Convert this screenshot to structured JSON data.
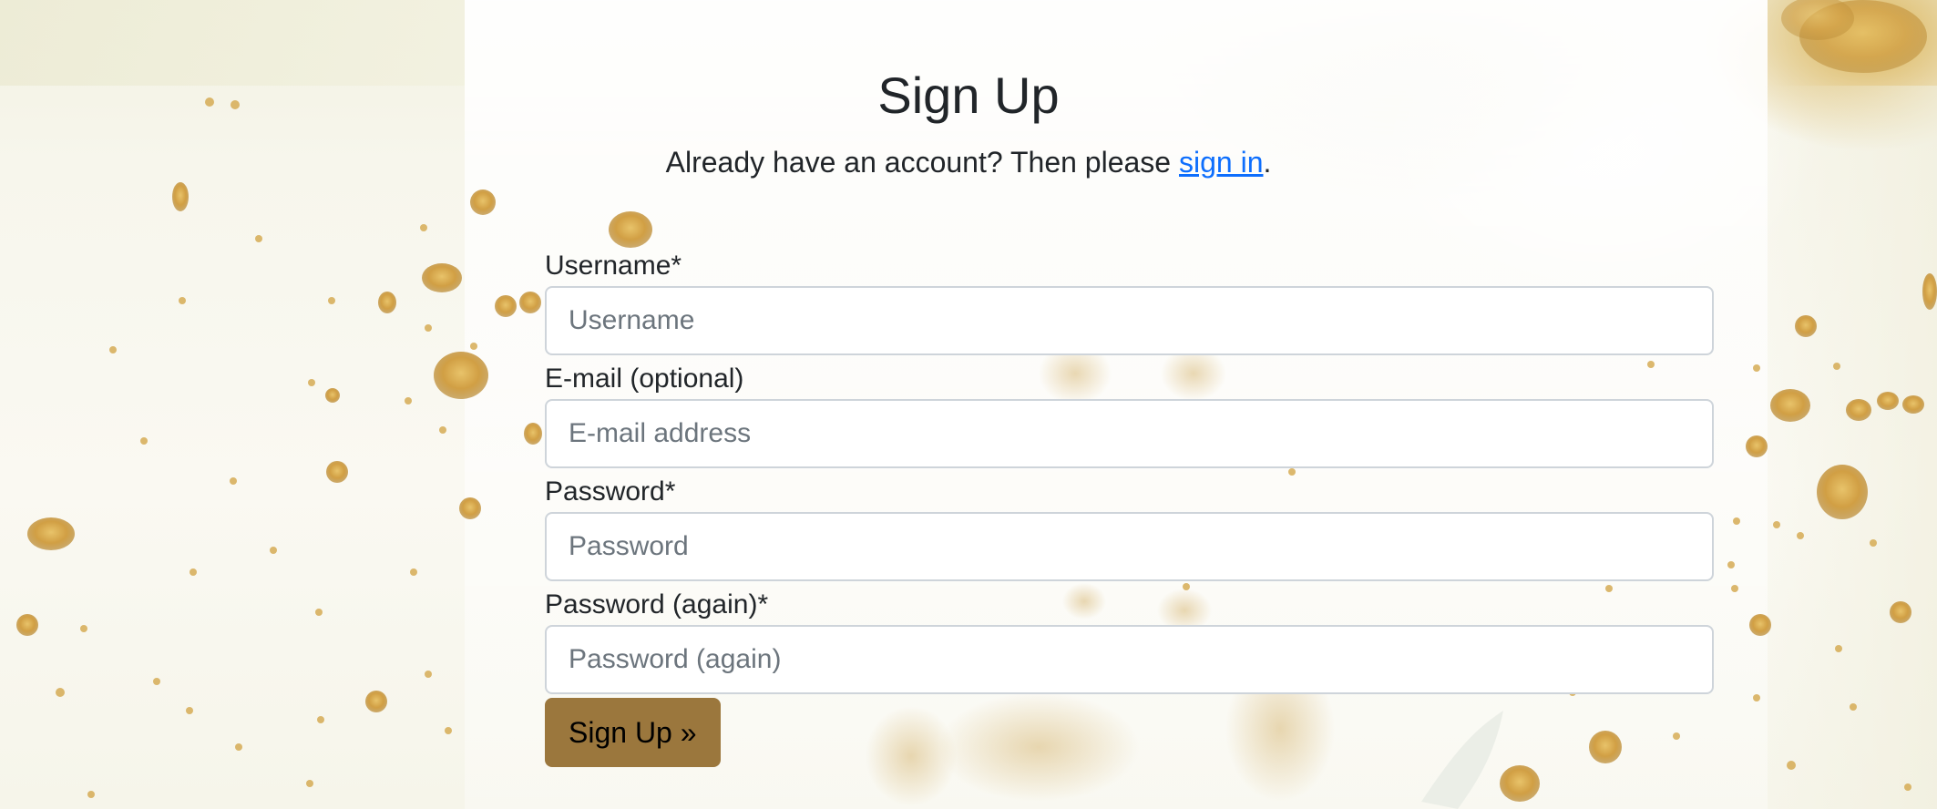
{
  "page": {
    "title": "Sign Up",
    "subtitle_prefix": "Already have an account? Then please ",
    "signin_link": "sign in",
    "subtitle_suffix": "."
  },
  "form": {
    "username": {
      "label": "Username*",
      "placeholder": "Username",
      "value": ""
    },
    "email": {
      "label": "E-mail (optional)",
      "placeholder": "E-mail address",
      "value": ""
    },
    "password": {
      "label": "Password*",
      "placeholder": "Password",
      "value": ""
    },
    "password2": {
      "label": "Password (again)*",
      "placeholder": "Password (again)",
      "value": ""
    },
    "submit_label": "Sign Up »"
  },
  "colors": {
    "link": "#0d6efd",
    "submit_button": "#9b773d",
    "input_border": "#ced4da",
    "placeholder": "#6c757d",
    "gold_accent": "#d4a84a"
  },
  "icons": [
    "gold-glitter-splash-background"
  ]
}
